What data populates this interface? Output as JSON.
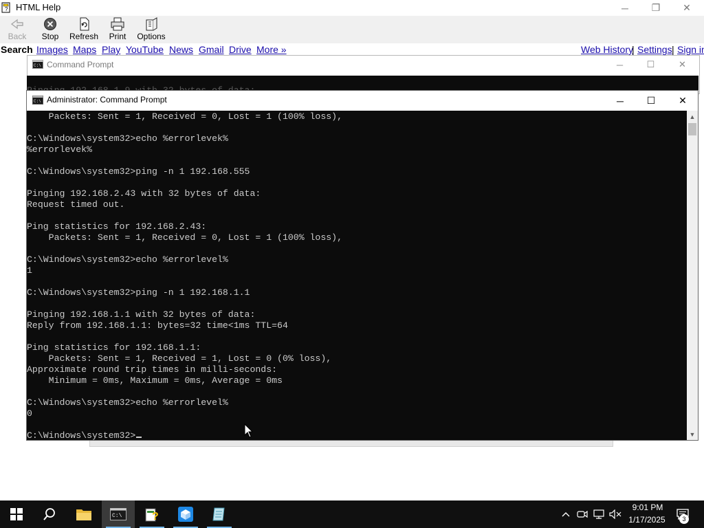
{
  "help_window": {
    "title": "HTML Help",
    "toolbar": {
      "back": "Back",
      "stop": "Stop",
      "refresh": "Refresh",
      "print": "Print",
      "options": "Options"
    },
    "links": {
      "search": "Search",
      "images": "Images",
      "maps": "Maps",
      "play": "Play",
      "youtube": "YouTube",
      "news": "News",
      "gmail": "Gmail",
      "drive": "Drive",
      "more": "More »",
      "web_history": "Web History",
      "settings": "Settings",
      "sign_in": "Sign in",
      "separator": "|"
    }
  },
  "background_cmd": {
    "title": "Command Prompt",
    "partial_text": "Pinging 192.168.1.9 with 32 bytes of data:"
  },
  "cmd": {
    "title": "Administrator: Command Prompt",
    "lines": [
      "    Packets: Sent = 1, Received = 0, Lost = 1 (100% loss),",
      "",
      "C:\\Windows\\system32>echo %errorlevek%",
      "%errorlevek%",
      "",
      "C:\\Windows\\system32>ping -n 1 192.168.555",
      "",
      "Pinging 192.168.2.43 with 32 bytes of data:",
      "Request timed out.",
      "",
      "Ping statistics for 192.168.2.43:",
      "    Packets: Sent = 1, Received = 0, Lost = 1 (100% loss),",
      "",
      "C:\\Windows\\system32>echo %errorlevel%",
      "1",
      "",
      "C:\\Windows\\system32>ping -n 1 192.168.1.1",
      "",
      "Pinging 192.168.1.1 with 32 bytes of data:",
      "Reply from 192.168.1.1: bytes=32 time<1ms TTL=64",
      "",
      "Ping statistics for 192.168.1.1:",
      "    Packets: Sent = 1, Received = 1, Lost = 0 (0% loss),",
      "Approximate round trip times in milli-seconds:",
      "    Minimum = 0ms, Maximum = 0ms, Average = 0ms",
      "",
      "C:\\Windows\\system32>echo %errorlevel%",
      "0",
      ""
    ],
    "prompt": "C:\\Windows\\system32>"
  },
  "taskbar": {
    "apps": [
      "start-icon",
      "search-icon",
      "file-explorer-icon",
      "command-prompt-icon",
      "html-help-icon",
      "virtualbox-icon",
      "notepad-icon"
    ],
    "tray_icons": [
      "chevron-up-icon",
      "meet-now-icon",
      "network-icon",
      "volume-muted-icon"
    ],
    "time": "9:01 PM",
    "date": "1/17/2025",
    "notification_count": "3"
  },
  "colors": {
    "console_bg": "#0c0c0c",
    "console_fg": "#cccccc",
    "link": "#1a0dab",
    "taskbar": "#101010",
    "taskbar_accent": "#76b9ed"
  }
}
